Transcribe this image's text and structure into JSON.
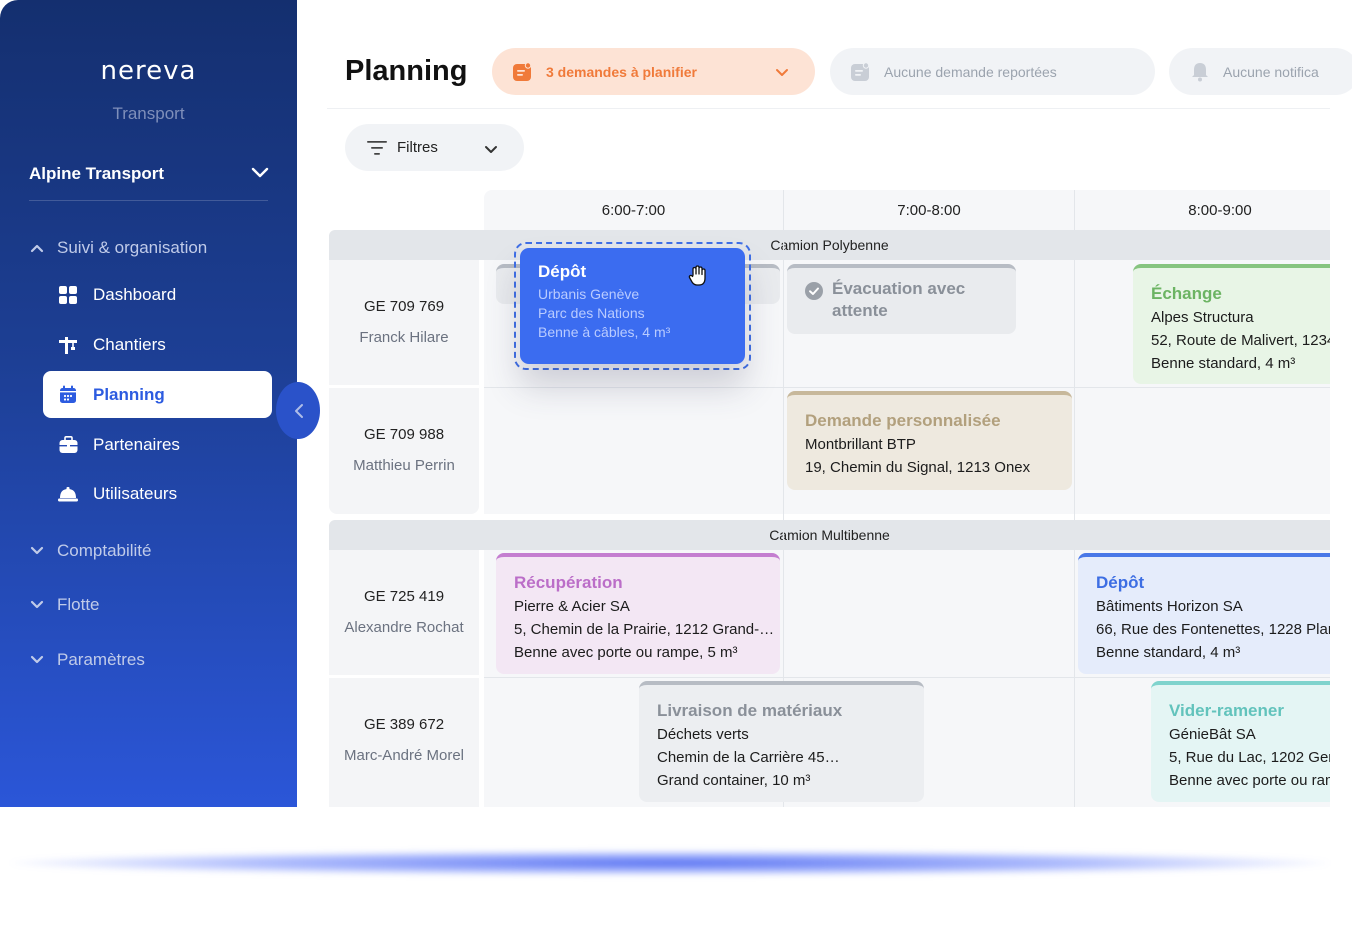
{
  "sidebar": {
    "logo": "nereva",
    "subtitle": "Transport",
    "org_name": "Alpine Transport",
    "section_suivi": "Suivi & organisation",
    "items": [
      {
        "label": "Dashboard"
      },
      {
        "label": "Chantiers"
      },
      {
        "label": "Planning"
      },
      {
        "label": "Partenaires"
      },
      {
        "label": "Utilisateurs"
      }
    ],
    "section_compta": "Comptabilité",
    "section_flotte": "Flotte",
    "section_params": "Paramètres"
  },
  "header": {
    "title": "Planning",
    "requests_to_plan": "3 demandes à planifier",
    "postponed": "Aucune demande reportées",
    "notifications": "Aucune notifica"
  },
  "filters": {
    "label": "Filtres"
  },
  "timeline": {
    "slots": [
      "6:00-7:00",
      "7:00-8:00",
      "8:00-9:00"
    ]
  },
  "groups": {
    "polybenne": "Camion Polybenne",
    "multibenne": "Camion Multibenne"
  },
  "rows": [
    {
      "plate": "GE 709 769",
      "driver": "Franck Hilare"
    },
    {
      "plate": "GE 709 988",
      "driver": "Matthieu Perrin"
    },
    {
      "plate": "GE 725 419",
      "driver": "Alexandre Rochat"
    },
    {
      "plate": "GE 389 672",
      "driver": "Marc-André Morel"
    }
  ],
  "drag_card": {
    "title": "Dépôt",
    "line1": "Urbanis Genève",
    "line2": "Parc des Nations",
    "line3": "Benne à câbles, 4 m³"
  },
  "cards": {
    "evacuation": {
      "title": "Évacuation avec attente"
    },
    "echange": {
      "title": "Échange",
      "client": "Alpes Structura",
      "address": "52, Route de Malivert, 1234",
      "container": "Benne standard, 4 m³"
    },
    "perso": {
      "title": "Demande personnalisée",
      "client": "Montbrillant BTP",
      "address": "19, Chemin du Signal, 1213 Onex"
    },
    "recup": {
      "title": "Récupération",
      "client": "Pierre & Acier SA",
      "address": "5, Chemin de la Prairie, 1212 Grand-…",
      "container": "Benne avec porte ou rampe, 5 m³"
    },
    "depot2": {
      "title": "Dépôt",
      "client": "Bâtiments Horizon SA",
      "address": "66, Rue des Fontenettes, 1228 Plan",
      "container": "Benne standard, 4 m³"
    },
    "livraison": {
      "title": "Livraison de matériaux",
      "client": "Déchets verts",
      "address": "Chemin de la Carrière 45…",
      "container": "Grand container, 10 m³"
    },
    "vider": {
      "title": "Vider-ramener",
      "client": "GénieBât SA",
      "address": "5, Rue du Lac, 1202 Gene",
      "container": "Benne avec porte ou ram"
    }
  }
}
